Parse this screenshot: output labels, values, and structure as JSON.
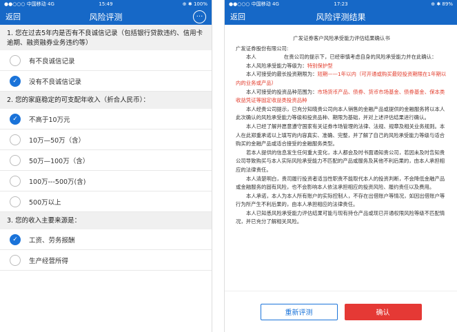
{
  "left": {
    "status": {
      "carrier": "●●○○○ 中国移动  4G",
      "time": "15:49",
      "battery": "⊕ ✱ 100%"
    },
    "nav": {
      "back": "返回",
      "title": "风险评测",
      "more": "···"
    },
    "q1": "1. 您在过去5年内是否有不良诚信记录（包括银行贷款违约、信用卡逾期、融资融券业务违约等）",
    "q1_options": [
      "有不良诚信记录",
      "没有不良诚信记录"
    ],
    "q2": "2. 您的家庭稳定的可支配年收入（折合人民币）：",
    "q2_options": [
      "不高于10万元",
      "10万—50万（含）",
      "50万—100万（含）",
      "100万---500万(含)",
      "500万以上"
    ],
    "q3": "3. 您的收入主要来源是：",
    "q3_options": [
      "工资、劳务报酬",
      "生产经营所得"
    ]
  },
  "right": {
    "status": {
      "carrier": "●●○○○ 中国移动  4G",
      "time": "17:23",
      "battery": "⊕ ✱ 89%"
    },
    "nav": {
      "back": "返回",
      "title": "风险评测结果"
    },
    "doc": {
      "title": "广发证券客户风险承受能力评估结果确认书",
      "to": "广发证券股份有限公司:",
      "p1a": "本人",
      "p1b": "在贵公司的提示下，已经审慎考虑自身的风险承受能力并在此确认：",
      "p2a": "本人风险承受能力等级为：",
      "p2b": "特别保护型",
      "p3a": "本人可接受的最长投资期限为：",
      "p3b": "短期——1年以内（可开通或购买最短投资期限在1年期以内的业务或产品）",
      "p4a": "本人可接受的投资品种范围为：",
      "p4b": "市场货币产品、债券、货币市场基金、债券基金、保本类收益凭证等固定收益类投资品种",
      "p5": "本人经贵公司提示，已充分知晓贵公司向本人销售的金融产品或提供的金融服务将以本人此次确认的风险承受能力等级和投资品种、期限为基础，并对上述评估结果进行确认。",
      "p6": "本人已经了解并愿意遵守国家有关证券市场管理的法律、法规、规章及相关业务规则。本人在此郑重承诺以上填写的内容真实、准确、完整，并了解了自己的风险承受能力等级与适合购买的金融产品或适合接受的金融服务类型。",
      "p7": "若本人提供的信息发生任何重大变化，本人都会及时书面通知贵公司，若因未及时告知贵公司导致购买与本人实际风险承受能力不匹配的产品或服务及其他不利后果的，由本人承担相应的法律责任。",
      "p8": "本人清楚明白，贵司履行投资者适当性职责不能取代本人的投资判断，不会降低金融产品或金融服务的固有风险，也不会影响本人依法承担相应的投资风险、履约责任以及费用。",
      "p9": "本人承诺，本人为本人所有账户的实际控制人，不存在出借账户等情况，如因出借账户等行为所产生不利后果的，由本人承担相应的法律责任。",
      "p10": "本人已知悉风险承受能力评估结果可能与现有持仓产品或现已开通权限风险等级不匹配情况，并已充分了解相关风险。"
    },
    "buttons": {
      "retest": "重新评测",
      "confirm": "确认"
    }
  },
  "colors": {
    "nav": "#1668c7",
    "accent": "#1a73d9",
    "warning_text": "#e23b2b",
    "confirm": "#e53935"
  }
}
